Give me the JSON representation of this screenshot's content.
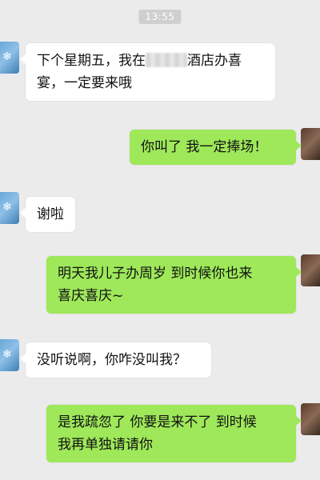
{
  "chat": {
    "timestamp": "13:55",
    "messages": [
      {
        "side": "left",
        "line1_before": "下个星期五，我在",
        "line1_after": "酒店办喜",
        "line2": "宴，一定要来哦"
      },
      {
        "side": "right",
        "text": "你叫了 我一定捧场！"
      },
      {
        "side": "left",
        "text": "谢啦"
      },
      {
        "side": "right",
        "line1": "明天我儿子办周岁 到时候你也来",
        "line2": "喜庆喜庆~"
      },
      {
        "side": "left",
        "text": "没听说啊，你咋没叫我？"
      },
      {
        "side": "right",
        "line1": "是我疏忽了 你要是来不了 到时候",
        "line2": "我再单独请请你"
      }
    ]
  },
  "colors": {
    "background": "#ebebeb",
    "received_bubble": "#ffffff",
    "sent_bubble": "#9ee85a"
  },
  "icons": {
    "left_avatar": "snowflake-avatar-icon",
    "right_avatar": "user-photo-avatar-icon"
  }
}
